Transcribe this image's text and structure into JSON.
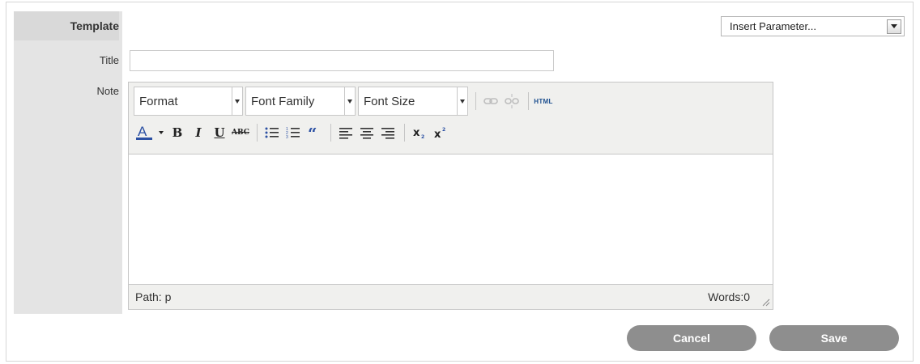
{
  "section": {
    "label": "Template"
  },
  "insert_parameter": {
    "value": "Insert Parameter..."
  },
  "fields": {
    "title_label": "Title",
    "title_value": "",
    "note_label": "Note"
  },
  "editor": {
    "format_label": "Format",
    "font_family_label": "Font Family",
    "font_size_label": "Font Size",
    "html_label": "HTML",
    "bold_label": "B",
    "italic_label": "I",
    "underline_label": "U",
    "strike_label": "ABC",
    "status_path": "Path: p",
    "word_count": "Words:0",
    "icons": [
      "link-icon",
      "unlink-icon",
      "html-icon",
      "text-color-icon",
      "bold-icon",
      "italic-icon",
      "underline-icon",
      "strikethrough-icon",
      "bullet-list-icon",
      "numbered-list-icon",
      "blockquote-icon",
      "align-left-icon",
      "align-center-icon",
      "align-right-icon",
      "subscript-icon",
      "superscript-icon"
    ]
  },
  "actions": {
    "cancel_label": "Cancel",
    "save_label": "Save"
  },
  "colors": {
    "label_bg": "#e4e4e4",
    "button_bg": "#8e8e8e",
    "text_color_underline": "#2b50a3"
  }
}
